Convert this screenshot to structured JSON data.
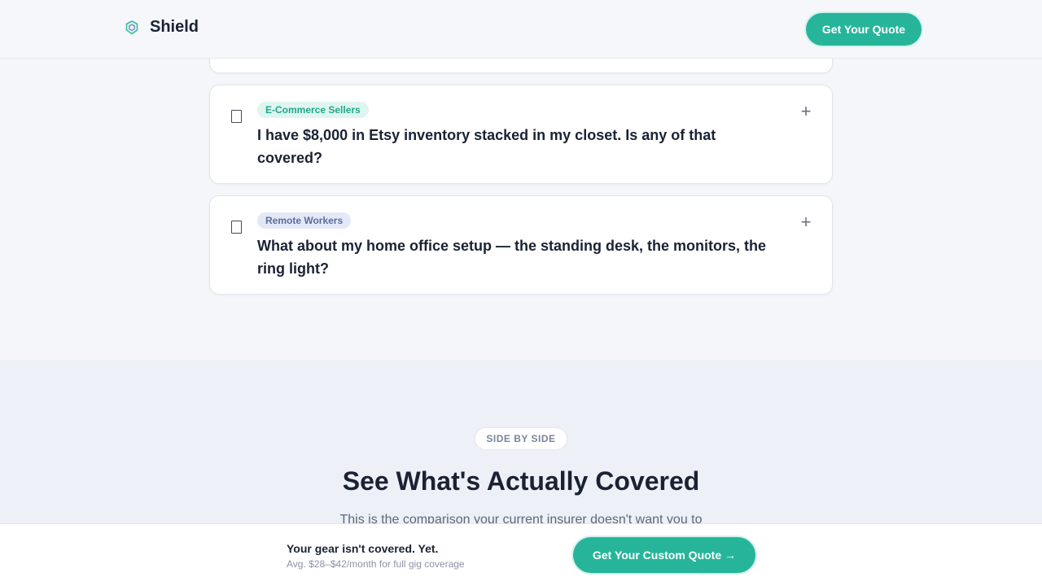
{
  "header": {
    "brand": "Shield",
    "cta_label": "Get Your Quote"
  },
  "faq": {
    "items": [
      {
        "tag": "E-Commerce Sellers",
        "question": "I have $8,000 in Etsy inventory stacked in my closet. Is any of that covered?",
        "toggle": "+"
      },
      {
        "tag": "Remote Workers",
        "question": "What about my home office setup — the standing desk, the monitors, the ring light?",
        "toggle": "+"
      }
    ]
  },
  "comparison": {
    "pill": "SIDE BY SIDE",
    "title": "See What's Actually Covered",
    "subtitle": "This is the comparison your current insurer doesn't want you to"
  },
  "bottom_bar": {
    "title": "Your gear isn't covered. Yet.",
    "subtitle": "Avg. $28–$42/month for full gig coverage",
    "cta_label": "Get Your Custom Quote →"
  },
  "colors": {
    "accent": "#26b59a",
    "tag_green_bg": "#dff5ef",
    "tag_blue_bg": "#e3e8f6"
  },
  "icons": {
    "brand": "shield-icon",
    "expand": "plus-icon",
    "card_glyph": "missing-glyph-icon"
  }
}
